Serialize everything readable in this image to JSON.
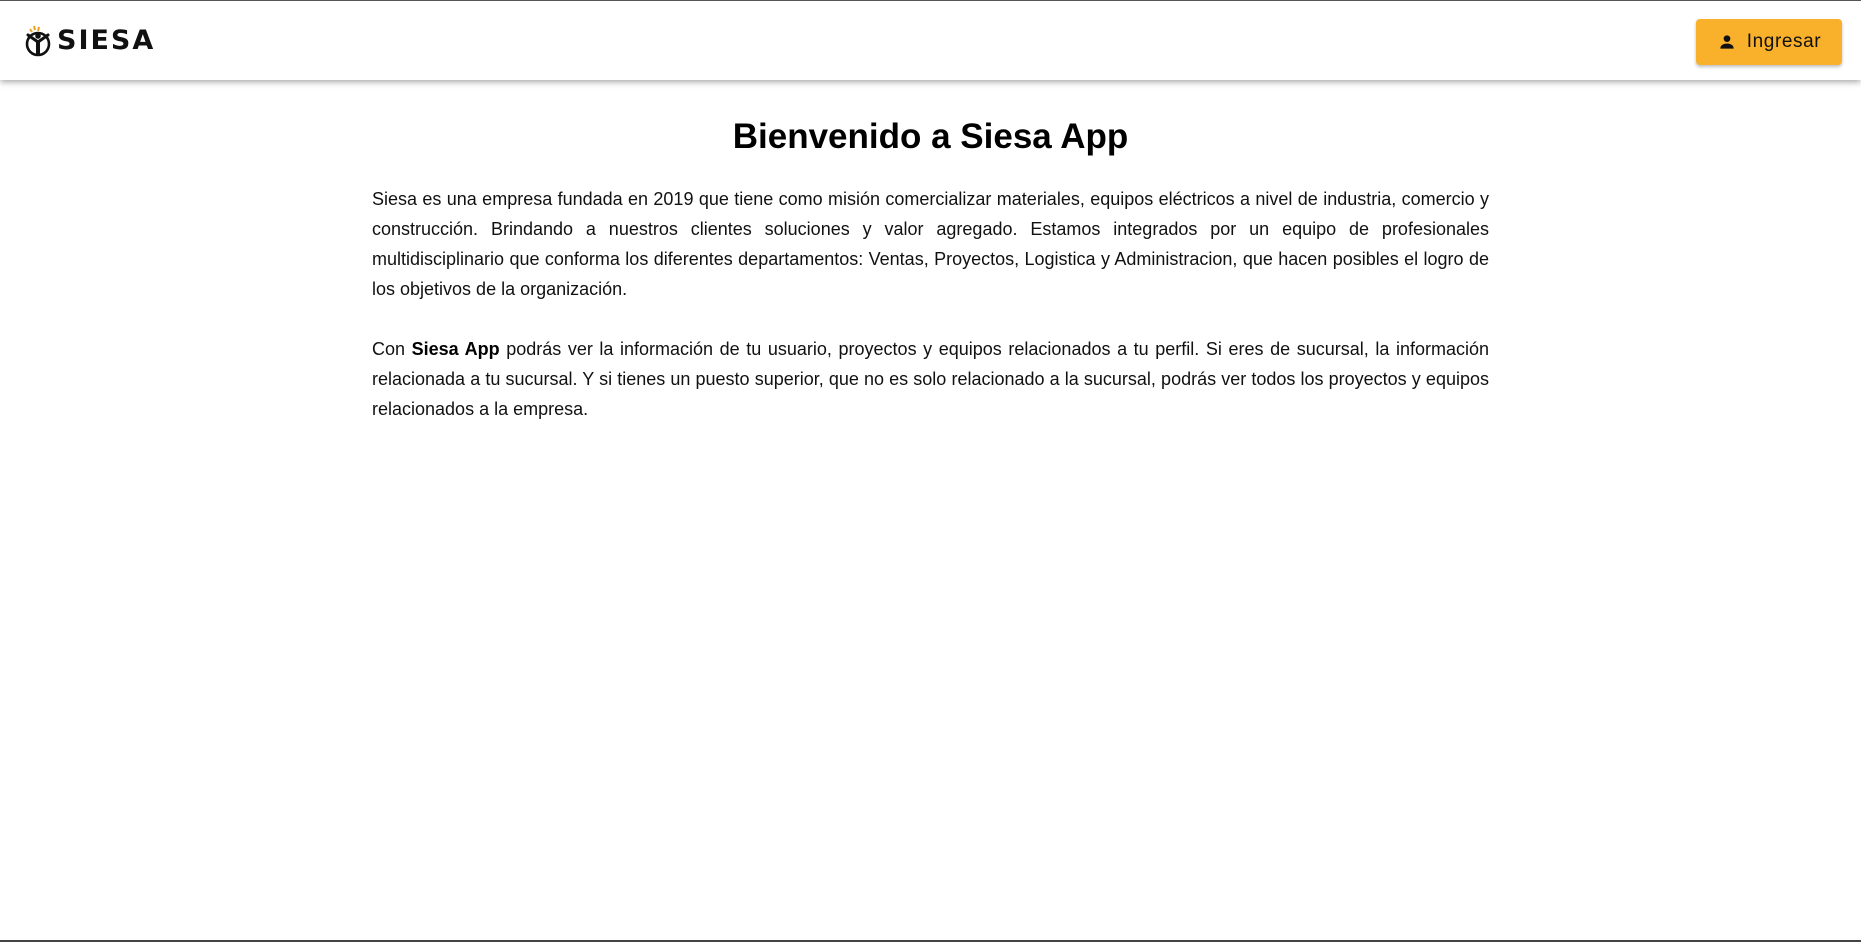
{
  "header": {
    "logo_text": "SIESA",
    "login_label": "Ingresar",
    "login_icon": "person-icon",
    "accent_color": "#f9b02a"
  },
  "main": {
    "title": "Bienvenido a Siesa App",
    "paragraph1": "Siesa es una empresa fundada en 2019 que tiene como misión comercializar materiales, equipos eléctricos a nivel de industria, comercio y construcción. Brindando a nuestros clientes soluciones y valor agregado. Estamos integrados por un equipo de profesionales multidisciplinario que conforma los diferentes departamentos: Ventas, Proyectos, Logistica y Administracion, que hacen posibles el logro de los objetivos de la organización.",
    "paragraph2_prefix": "Con ",
    "paragraph2_bold": "Siesa App",
    "paragraph2_suffix": " podrás ver la información de tu usuario, proyectos y equipos relacionados a tu perfil. Si eres de sucursal, la información relacionada a tu sucursal. Y si tienes un puesto superior, que no es solo relacionado a la sucursal, podrás ver todos los proyectos y equipos relacionados a la empresa."
  }
}
